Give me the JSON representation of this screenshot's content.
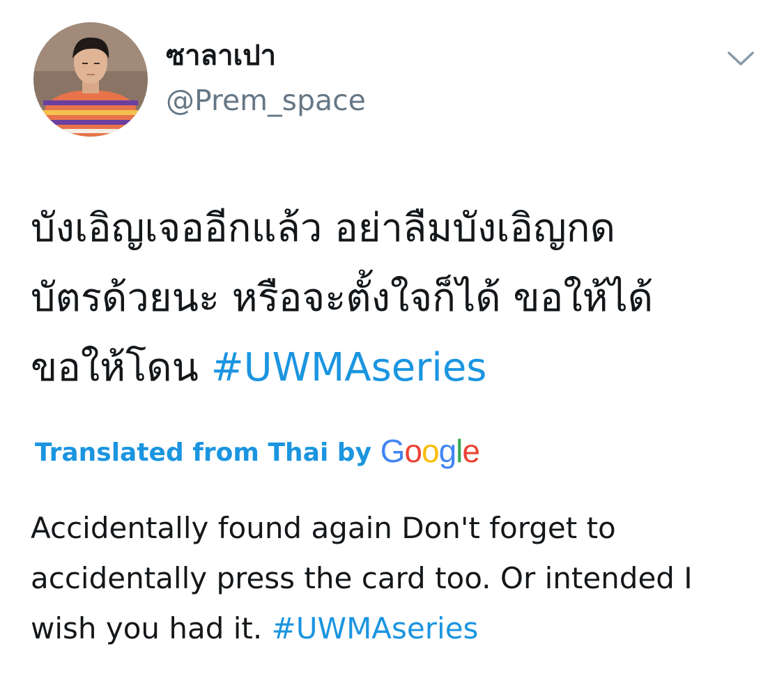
{
  "author": {
    "display_name": "ซาลาเปา",
    "handle": "@Prem_space",
    "avatar_icon": "profile-photo"
  },
  "header": {
    "menu_icon": "chevron-down-icon"
  },
  "tweet": {
    "lines": [
      "บังเอิญเจออีกแล้ว อย่าลืมบังเอิญกด",
      "บัตรด้วยนะ หรือจะตั้งใจก็ได้ ขอให้ได้",
      "ขอให้โดน "
    ],
    "hashtag": "#UWMAseries"
  },
  "translation": {
    "attribution": "Translated from Thai by",
    "logo_letters": [
      "G",
      "o",
      "o",
      "g",
      "l",
      "e"
    ],
    "lines": [
      "Accidentally found again Don't forget to",
      "accidentally press the card too. Or intended I",
      "wish you had it. "
    ],
    "hashtag": "#UWMAseries"
  },
  "colors": {
    "link": "#1b95e0",
    "text": "#14171a",
    "secondary": "#657786"
  }
}
